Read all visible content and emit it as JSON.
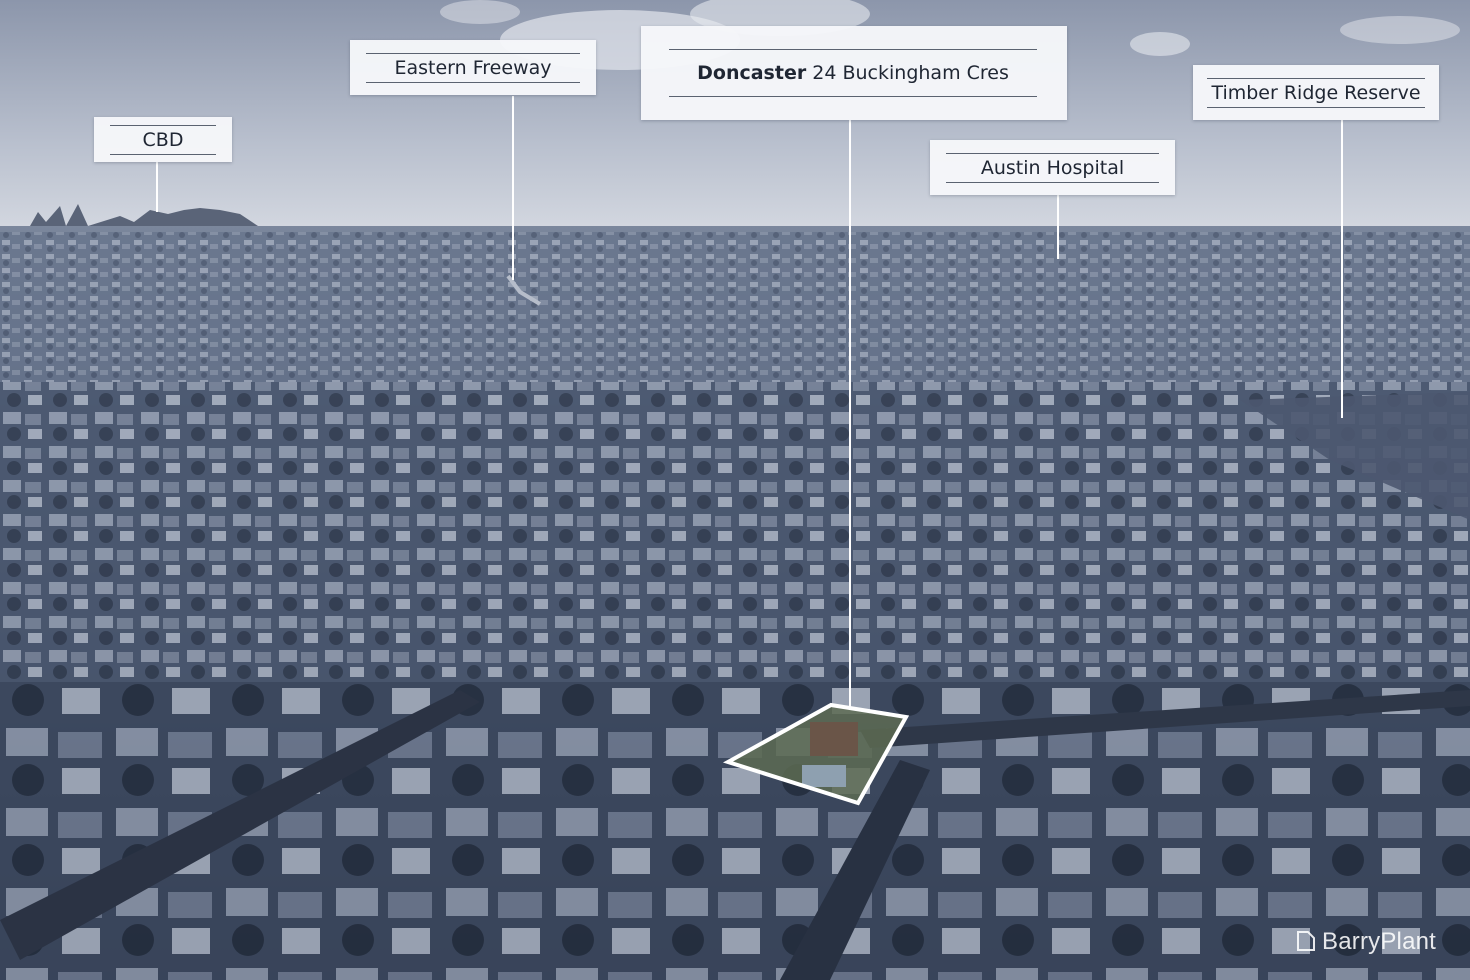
{
  "labels": {
    "cbd": "CBD",
    "eastern_freeway": "Eastern Freeway",
    "property_suburb": "Doncaster",
    "property_address": "24 Buckingham Cres",
    "austin_hospital": "Austin Hospital",
    "timber_ridge": "Timber Ridge Reserve"
  },
  "watermark": {
    "brand": "BarryPlant"
  },
  "colors": {
    "label_bg": "#f6f7fa",
    "pin": "#ffffff",
    "boundary": "#ffffff",
    "tint": "#2a3447"
  }
}
